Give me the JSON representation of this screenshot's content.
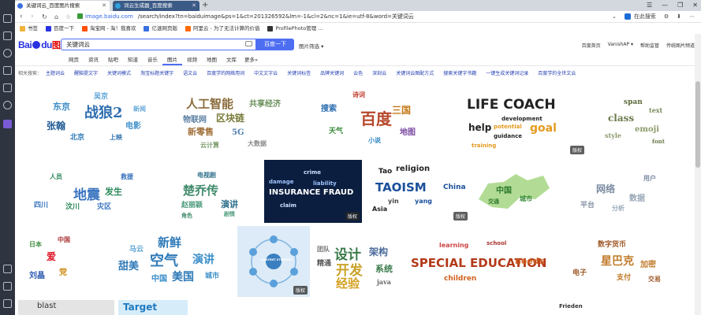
{
  "browser": {
    "tabs": [
      {
        "title": "关键词云_百度图片搜索"
      },
      {
        "title": "词云生成器_百度搜索"
      }
    ],
    "new_tab": "+",
    "window_controls": [
      "☰",
      "—",
      "❐",
      "✕"
    ],
    "url_site": "image.baidu.com",
    "url_path": "/search/index?tn=baiduimage&ps=1&ct=201326592&lm=-1&cl=2&nc=1&ie=utf-8&word=关键词云",
    "side_search": "在此搜索",
    "bookmarks": [
      {
        "label": "书签",
        "color": "#f1b33c"
      },
      {
        "label": "百度一下",
        "color": "#2932e1"
      },
      {
        "label": "淘宝网 - 淘！我喜欢",
        "color": "#ff5000"
      },
      {
        "label": "亿速网页版",
        "color": "#3a6fe0"
      },
      {
        "label": "阿里云 - 为了无法计算的价值",
        "color": "#ff6a00"
      },
      {
        "label": "ProfilePhoto管理 ...",
        "color": "#333333"
      }
    ]
  },
  "baidu": {
    "logo_left": "Bai",
    "logo_right": "du",
    "logo_pic": "图片",
    "query": "关键词云",
    "search_button": "百度一下",
    "filter_link": "图片筛选 ▾",
    "header_links": [
      "百度首页",
      "VanishAP ▾",
      "帮助监管",
      "传统图片频道"
    ],
    "categories": [
      "网页",
      "资讯",
      "贴吧",
      "知道",
      "音乐",
      "图片",
      "视频",
      "地图",
      "文库",
      "更多»"
    ],
    "active_category": "图片",
    "related_label": "相关搜索：",
    "related": [
      "主题词云",
      "醒脑提文字",
      "关键词模式",
      "淘宝标题关键字",
      "语文云",
      "百度学的网络用词",
      "中文文字云",
      "关键词标签",
      "品牌关键词",
      "云色",
      "深刻云",
      "关键词云图配方式",
      "搜索关键字书籍",
      "一键生成关键词记录",
      "百度学的全世文云"
    ]
  },
  "images": {
    "badge_label": "版权",
    "row1": [
      {
        "words": [
          "战狼2",
          "东京",
          "张翰",
          "电影",
          "北京",
          "吴京",
          "上映",
          "新闻"
        ]
      },
      {
        "words": [
          "人工智能",
          "物联网",
          "区块链",
          "共享经济",
          "新零售",
          "5G",
          "大数据",
          "云计算"
        ]
      },
      {
        "words": [
          "百度",
          "搜索",
          "三国",
          "天气",
          "地图",
          "诗词",
          "小说"
        ]
      },
      {
        "words": [
          "LIFE COACH",
          "goal",
          "help",
          "potential",
          "development",
          "guidance",
          "training"
        ]
      },
      {
        "words": [
          "class",
          "emoji",
          "span",
          "text",
          "style",
          "font"
        ]
      }
    ],
    "row2": [
      {
        "words": [
          "地震",
          "发生",
          "四川",
          "汶川",
          "灾区",
          "人员",
          "救援"
        ]
      },
      {
        "words": [
          "楚乔传",
          "演讲",
          "赵丽颖",
          "电视剧",
          "剧情",
          "角色"
        ]
      },
      {
        "words": [
          "INSURANCE FRAUD",
          "liability",
          "crime",
          "damage",
          "claim"
        ]
      },
      {
        "words": [
          "TAOISM",
          "religion",
          "Tao",
          "China",
          "yin",
          "yang",
          "Asia"
        ]
      },
      {
        "words": [
          "中国",
          "城市",
          "交通"
        ]
      },
      {
        "words": [
          "网络",
          "数据",
          "平台",
          "用户",
          "分析"
        ]
      }
    ],
    "row3": [
      {
        "words": [
          "爱",
          "党",
          "刘晶",
          "日本",
          "中国"
        ]
      },
      {
        "words": [
          "新鲜",
          "空气",
          "演讲",
          "甜美",
          "中国",
          "美国",
          "城市",
          "马云"
        ]
      },
      {
        "words": [
          "CONTENT STRATEGY"
        ]
      },
      {
        "words": [
          "设计",
          "开发",
          "架构",
          "经验",
          "系统",
          "精通",
          "团队",
          "java"
        ]
      },
      {
        "words": [
          "SPECIAL EDUCATION",
          "needs",
          "learning",
          "children",
          "school"
        ]
      },
      {
        "words": [
          "星巴克",
          "数字货币",
          "加密",
          "电子",
          "支付",
          "交易"
        ]
      }
    ],
    "row4": [
      {
        "words": [
          "blast"
        ]
      },
      {
        "words": [
          "Target"
        ]
      },
      {
        "words": [
          "Frieden"
        ]
      }
    ]
  },
  "colors": {
    "sidebar": "#2e3440",
    "tabbar": "#d3d8de",
    "accent": "#4e6ef2",
    "baidu_red": "#e10601",
    "baidu_blue": "#2932e1"
  }
}
